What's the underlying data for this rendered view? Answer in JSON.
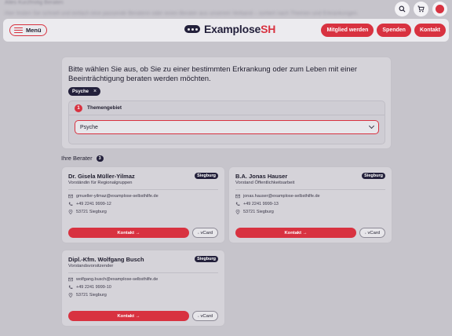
{
  "top": {
    "blur_text": "Alles Kurzfristig Beraten",
    "blur_text2": "Hier finden Sie schnell und einfach eine passende Beraterin oder einen Berater aus unserem Verband – sortiert nach Themen und Erkrankungen."
  },
  "header": {
    "menu_label": "Menü",
    "logo_main": "Examplose",
    "logo_accent": "SH",
    "actions": [
      "Mitglied werden",
      "Spenden",
      "Kontakt"
    ]
  },
  "topic": {
    "title": "Bitte wählen Sie aus, ob Sie zu einer bestimmten Erkrankung oder zum Leben mit einer Beeinträchtigung beraten werden möchten.",
    "chip": "Psyche",
    "step_number": "1",
    "step_label": "Themengebiet",
    "select_value": "Psyche"
  },
  "advisors": {
    "title": "Ihre Berater",
    "count": "3",
    "contact_label": "Kontakt →",
    "vcard_label": "vCard",
    "items": [
      {
        "name": "Dr. Gisela Müller-Yilmaz",
        "role": "Vorständin für Regionalgruppen",
        "location": "Siegburg",
        "email": "gmueller-yilmaz@examplose-selbsthilfe.de",
        "phone": "+49 2241 9999-12",
        "address": "53721 Siegburg"
      },
      {
        "name": "B.A. Jonas Hauser",
        "role": "Vorstand Öffentlichkeitsarbeit",
        "location": "Siegburg",
        "email": "jonas.hauser@examplose-selbsthilfe.de",
        "phone": "+49 2241 9999-13",
        "address": "53721 Siegburg"
      },
      {
        "name": "Dipl.-Kfm. Wolfgang Busch",
        "role": "Vorstandsvorsitzender",
        "location": "Siegburg",
        "email": "wolfgang.busch@examplose-selbsthilfe.de",
        "phone": "+49 2241 9999-10",
        "address": "53721 Siegburg"
      }
    ]
  }
}
